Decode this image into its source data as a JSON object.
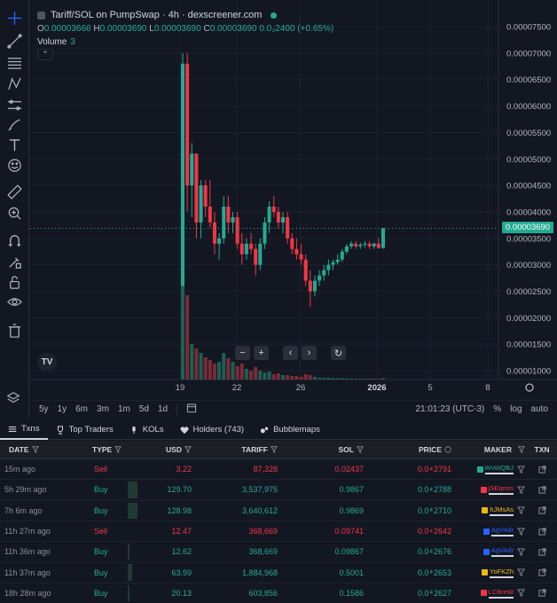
{
  "legend": {
    "title": "Tariff/SOL on PumpSwap · 4h · dexscreener.com",
    "open_label": "O",
    "open": "0.00003666",
    "high_label": "H",
    "high": "0.00003690",
    "low_label": "L",
    "low": "0.00003690",
    "close_label": "C",
    "close": "0.00003690",
    "change": "0.0₃2400 (+0.65%)",
    "volume_label": "Volume",
    "volume": "3"
  },
  "price_axis": [
    "0.00007500",
    "0.00007000",
    "0.00006500",
    "0.00006000",
    "0.00005500",
    "0.00005000",
    "0.00004500",
    "0.00004000",
    "0.00003500",
    "0.00003000",
    "0.00002500",
    "0.00002000",
    "0.00001500",
    "0.00001000"
  ],
  "current_price": "0.00003690",
  "time_axis": [
    "19",
    "22",
    "26",
    "2026",
    "5",
    "8"
  ],
  "timeframes": [
    "5y",
    "1y",
    "6m",
    "3m",
    "1m",
    "5d",
    "1d"
  ],
  "bottom_right": {
    "time": "21:01:23 (UTC-3)",
    "percent": "%",
    "log": "log",
    "auto": "auto"
  },
  "tabs": [
    {
      "label": "Txns",
      "icon": "list-icon"
    },
    {
      "label": "Top Traders",
      "icon": "trophy-icon"
    },
    {
      "label": "KOLs",
      "icon": "mic-icon"
    },
    {
      "label": "Holders (743)",
      "icon": "heart-icon"
    },
    {
      "label": "Bubblemaps",
      "icon": "bubbles-icon"
    }
  ],
  "table": {
    "headers": {
      "date": "DATE",
      "type": "TYPE",
      "usd": "USD",
      "tariff": "TARIFF",
      "sol": "SOL",
      "price": "PRICE",
      "maker": "MAKER",
      "txn": "TXN"
    },
    "rows": [
      {
        "date": "15m ago",
        "type": "Sell",
        "usd": "3.22",
        "tariff": "87,328",
        "sol": "0.02437",
        "price_a": "0.0",
        "price_sub": "4",
        "price_b": "2791",
        "maker": "WvWQBJ",
        "maker_color": "#22ab94",
        "usd_bar": 0.0
      },
      {
        "date": "5h 29m ago",
        "type": "Buy",
        "usd": "129.70",
        "tariff": "3,537,975",
        "sol": "0.9867",
        "price_a": "0.0",
        "price_sub": "4",
        "price_b": "2788",
        "maker": "jSEqmm",
        "maker_color": "#f23645",
        "usd_bar": 0.14
      },
      {
        "date": "7h 6m ago",
        "type": "Buy",
        "usd": "128.98",
        "tariff": "3,640,612",
        "sol": "0.9869",
        "price_a": "0.0",
        "price_sub": "4",
        "price_b": "2710",
        "maker": "hJMsAs",
        "maker_color": "#f0b90b",
        "usd_bar": 0.14
      },
      {
        "date": "11h 27m ago",
        "type": "Sell",
        "usd": "12.47",
        "tariff": "368,669",
        "sol": "0.09741",
        "price_a": "0.0",
        "price_sub": "4",
        "price_b": "2642",
        "maker": "AgVAdr",
        "maker_color": "#2962ff",
        "usd_bar": 0.0
      },
      {
        "date": "11h 36m ago",
        "type": "Buy",
        "usd": "12.62",
        "tariff": "368,669",
        "sol": "0.09867",
        "price_a": "0.0",
        "price_sub": "4",
        "price_b": "2676",
        "maker": "AgVAdr",
        "maker_color": "#2962ff",
        "usd_bar": 0.02
      },
      {
        "date": "11h 37m ago",
        "type": "Buy",
        "usd": "63.99",
        "tariff": "1,884,968",
        "sol": "0.5001",
        "price_a": "0.0",
        "price_sub": "4",
        "price_b": "2653",
        "maker": "YoFKZh",
        "maker_color": "#f0b90b",
        "usd_bar": 0.07
      },
      {
        "date": "18h 28m ago",
        "type": "Buy",
        "usd": "20.13",
        "tariff": "603,856",
        "sol": "0.1586",
        "price_a": "0.0",
        "price_sub": "4",
        "price_b": "2627",
        "maker": "LCBreW",
        "maker_color": "#f23645",
        "usd_bar": 0.03
      }
    ]
  },
  "colors": {
    "up": "#22ab94",
    "down": "#f23645",
    "bg": "#131722"
  }
}
